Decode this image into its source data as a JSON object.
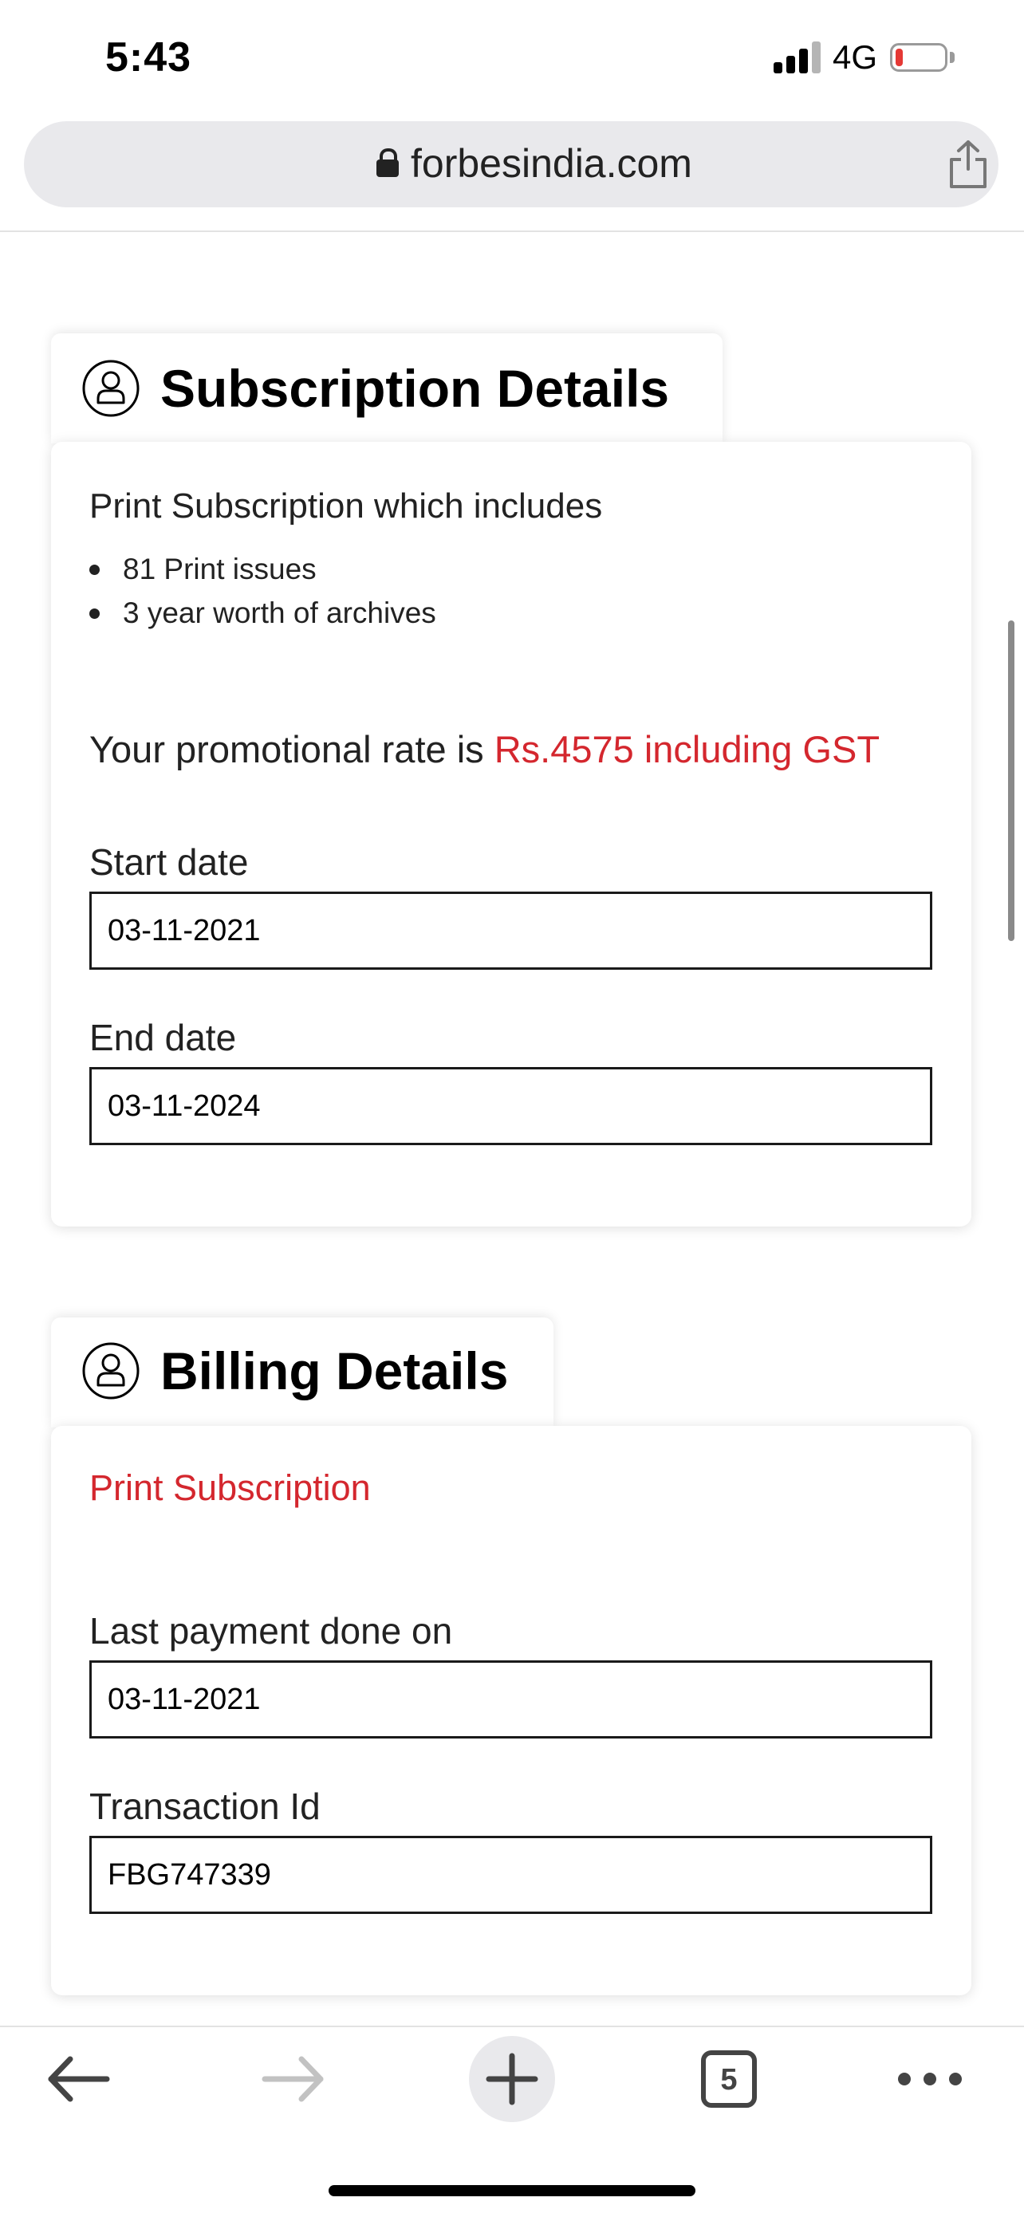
{
  "status_bar": {
    "time": "5:43",
    "network": "4G",
    "battery_level": 0.15,
    "battery_color": "#e53935"
  },
  "browser": {
    "url": "forbesindia.com",
    "lock_icon": "lock-icon",
    "share_icon": "share-icon"
  },
  "subscription": {
    "heading": "Subscription Details",
    "heading_icon": "user-icon",
    "intro": "Print Subscription which includes",
    "includes": [
      "81 Print issues",
      "3 year worth of archives"
    ],
    "rate_prefix": "Your promotional rate is",
    "rate_value": "Rs.4575 including GST",
    "start_date_label": "Start date",
    "start_date": "03-11-2021",
    "end_date_label": "End date",
    "end_date": "03-11-2024"
  },
  "billing": {
    "heading": "Billing Details",
    "heading_icon": "user-icon",
    "plan": "Print Subscription",
    "last_payment_label": "Last payment done on",
    "last_payment": "03-11-2021",
    "transaction_label": "Transaction Id",
    "transaction_id": "FBG747339"
  },
  "toolbar": {
    "back_icon": "back-arrow-icon",
    "forward_icon": "forward-arrow-icon",
    "new_tab_icon": "plus-icon",
    "tab_count": "5",
    "more_icon": "more-icon"
  },
  "colors": {
    "accent": "#d4272e",
    "url_bar": "#e9e9ec"
  }
}
